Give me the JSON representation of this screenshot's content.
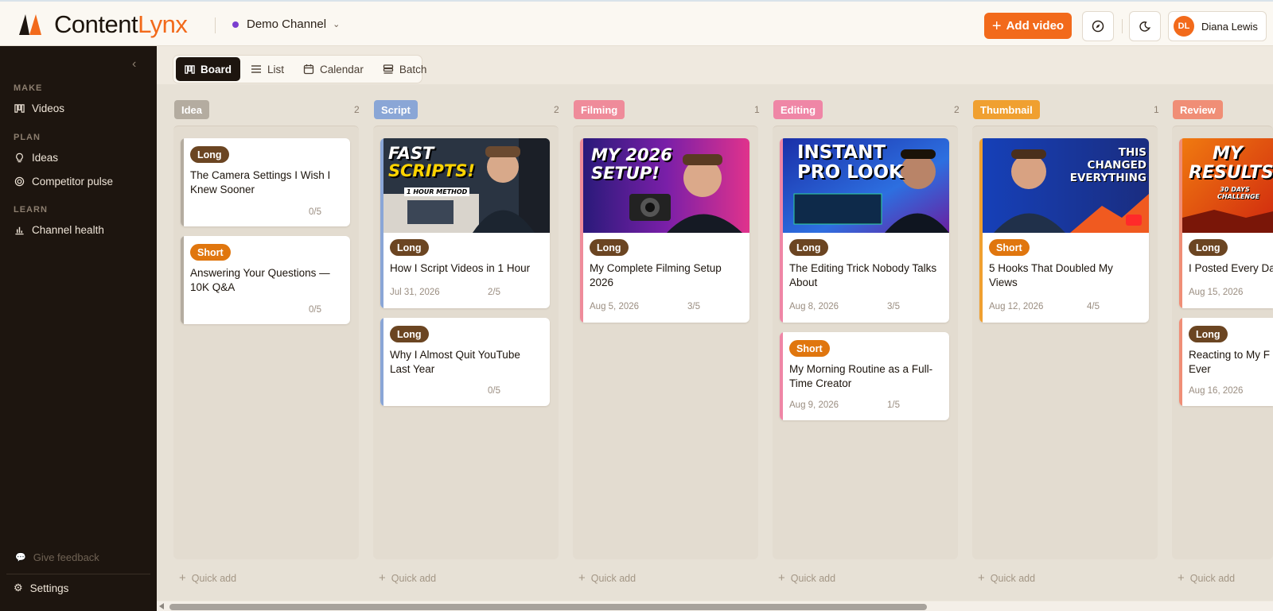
{
  "app": {
    "logo_primary": "Content",
    "logo_accent": "Lynx"
  },
  "header": {
    "channel": "Demo Channel",
    "add_video": "Add video",
    "user_initials": "DL",
    "user_name": "Diana Lewis"
  },
  "sidebar": {
    "sections": [
      {
        "title": "MAKE",
        "items": [
          {
            "label": "Videos",
            "icon": "board-icon"
          }
        ]
      },
      {
        "title": "PLAN",
        "items": [
          {
            "label": "Ideas",
            "icon": "lightbulb-icon"
          },
          {
            "label": "Competitor pulse",
            "icon": "target-icon"
          }
        ]
      },
      {
        "title": "LEARN",
        "items": [
          {
            "label": "Channel health",
            "icon": "bar-chart-icon"
          }
        ]
      }
    ],
    "feedback": "Give feedback",
    "settings": "Settings"
  },
  "view_tabs": [
    {
      "label": "Board",
      "active": true
    },
    {
      "label": "List",
      "active": false
    },
    {
      "label": "Calendar",
      "active": false
    },
    {
      "label": "Batch",
      "active": false
    }
  ],
  "quick_add": "Quick add",
  "columns": [
    {
      "stage": "Idea",
      "count": "2",
      "color": "#b4aca0",
      "cards": [
        {
          "type": "Long",
          "title": "The Camera Settings I Wish I Knew Sooner",
          "date": "",
          "progress": "0/5"
        },
        {
          "type": "Short",
          "title": "Answering Your Questions — 10K Q&A",
          "date": "",
          "progress": "0/5"
        }
      ]
    },
    {
      "stage": "Script",
      "count": "2",
      "color": "#8aa6d6",
      "cards": [
        {
          "type": "Long",
          "title": "How I Script Videos in 1 Hour",
          "date": "Jul 31, 2026",
          "progress": "2/5",
          "thumb": {
            "line1": "FAST",
            "line2": "SCRIPTS!",
            "sub": "1 HOUR METHOD"
          }
        },
        {
          "type": "Long",
          "title": "Why I Almost Quit YouTube Last Year",
          "date": "",
          "progress": "0/5"
        }
      ]
    },
    {
      "stage": "Filming",
      "count": "1",
      "color": "#ef8b9a",
      "cards": [
        {
          "type": "Long",
          "title": "My Complete Filming Setup 2026",
          "date": "Aug 5, 2026",
          "progress": "3/5",
          "thumb": {
            "line1": "MY 2026",
            "line2": "SETUP!",
            "sub": ""
          }
        }
      ]
    },
    {
      "stage": "Editing",
      "count": "2",
      "color": "#ef86a6",
      "cards": [
        {
          "type": "Long",
          "title": "The Editing Trick Nobody Talks About",
          "date": "Aug 8, 2026",
          "progress": "3/5",
          "thumb": {
            "line1": "INSTANT",
            "line2": "PRO LOOK",
            "sub": ""
          }
        },
        {
          "type": "Short",
          "title": "My Morning Routine as a Full-Time Creator",
          "date": "Aug 9, 2026",
          "progress": "1/5"
        }
      ]
    },
    {
      "stage": "Thumbnail",
      "count": "1",
      "color": "#f0a030",
      "cards": [
        {
          "type": "Short",
          "title": "5 Hooks That Doubled My Views",
          "date": "Aug 12, 2026",
          "progress": "4/5",
          "thumb": {
            "line1": "THIS CHANGED",
            "line2": "EVERYTHING",
            "sub": ""
          }
        }
      ]
    },
    {
      "stage": "Review",
      "count": "",
      "color": "#f08e76",
      "cards": [
        {
          "type": "Long",
          "title": "I Posted Every Da",
          "date": "Aug 15, 2026",
          "progress": "",
          "thumb": {
            "line1": "MY",
            "line2": "RESULTS",
            "sub": "30 DAYS CHALLENGE"
          }
        },
        {
          "type": "Long",
          "title": "Reacting to My F Ever",
          "date": "Aug 16, 2026",
          "progress": ""
        }
      ]
    }
  ]
}
